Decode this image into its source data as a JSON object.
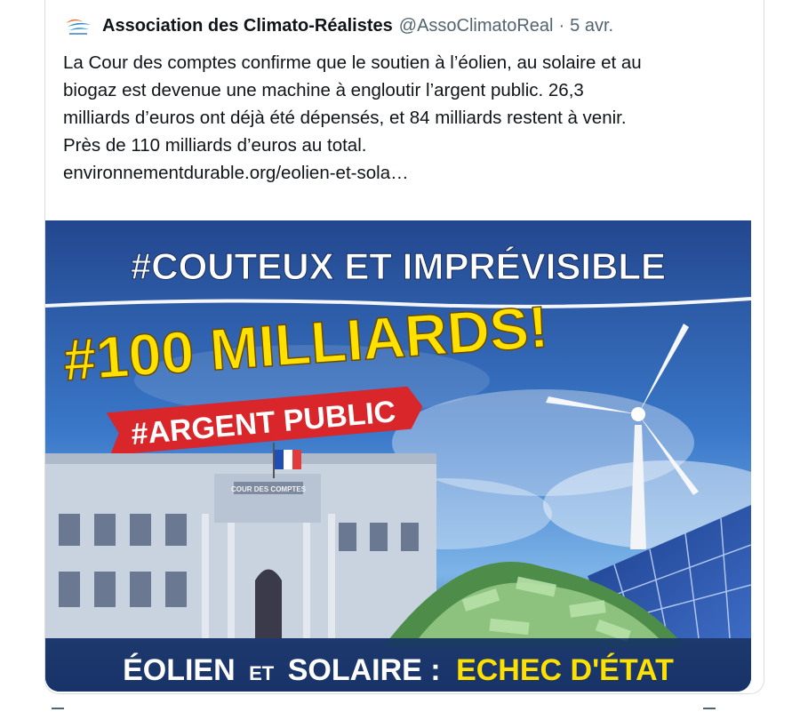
{
  "tweet": {
    "author_name": "Association des Climato-Réalistes",
    "author_handle": "@AssoClimatoReal",
    "separator": "·",
    "date": "5 avr.",
    "text_lines": [
      "La Cour des comptes confirme que le soutien à l’éolien, au solaire et au",
      "biogaz est devenue une machine à engloutir l’argent public. 26,3",
      "milliards d’euros ont déjà été dépensés, et 84 milliards restent à venir.",
      "Près de 110 milliards d’euros au total."
    ],
    "link_text": "environnementdurable.org/eolien-et-sola…"
  },
  "media": {
    "headline": "#COUTEUX ET IMPRÉVISIBLE",
    "big_text": "#100 MILLIARDS!",
    "banner_text": "#ARGENT PUBLIC",
    "building_sign": "COUR DES COMPTES",
    "footer_part1": "ÉOLIEN",
    "footer_part2": "ET",
    "footer_part3": "SOLAIRE :",
    "footer_part4": "ECHEC D'ÉTAT"
  },
  "colors": {
    "accent": "#1d9bf0",
    "text": "#0f1419",
    "secondary": "#536471",
    "image_yellow": "#ffe100",
    "image_red": "#d9262b"
  },
  "icons": {
    "avatar": "logo-icon",
    "wind_turbine": "wind-turbine-icon",
    "solar_panel": "solar-panel-icon",
    "money_pile": "money-pile-icon",
    "flag": "french-flag-icon"
  }
}
